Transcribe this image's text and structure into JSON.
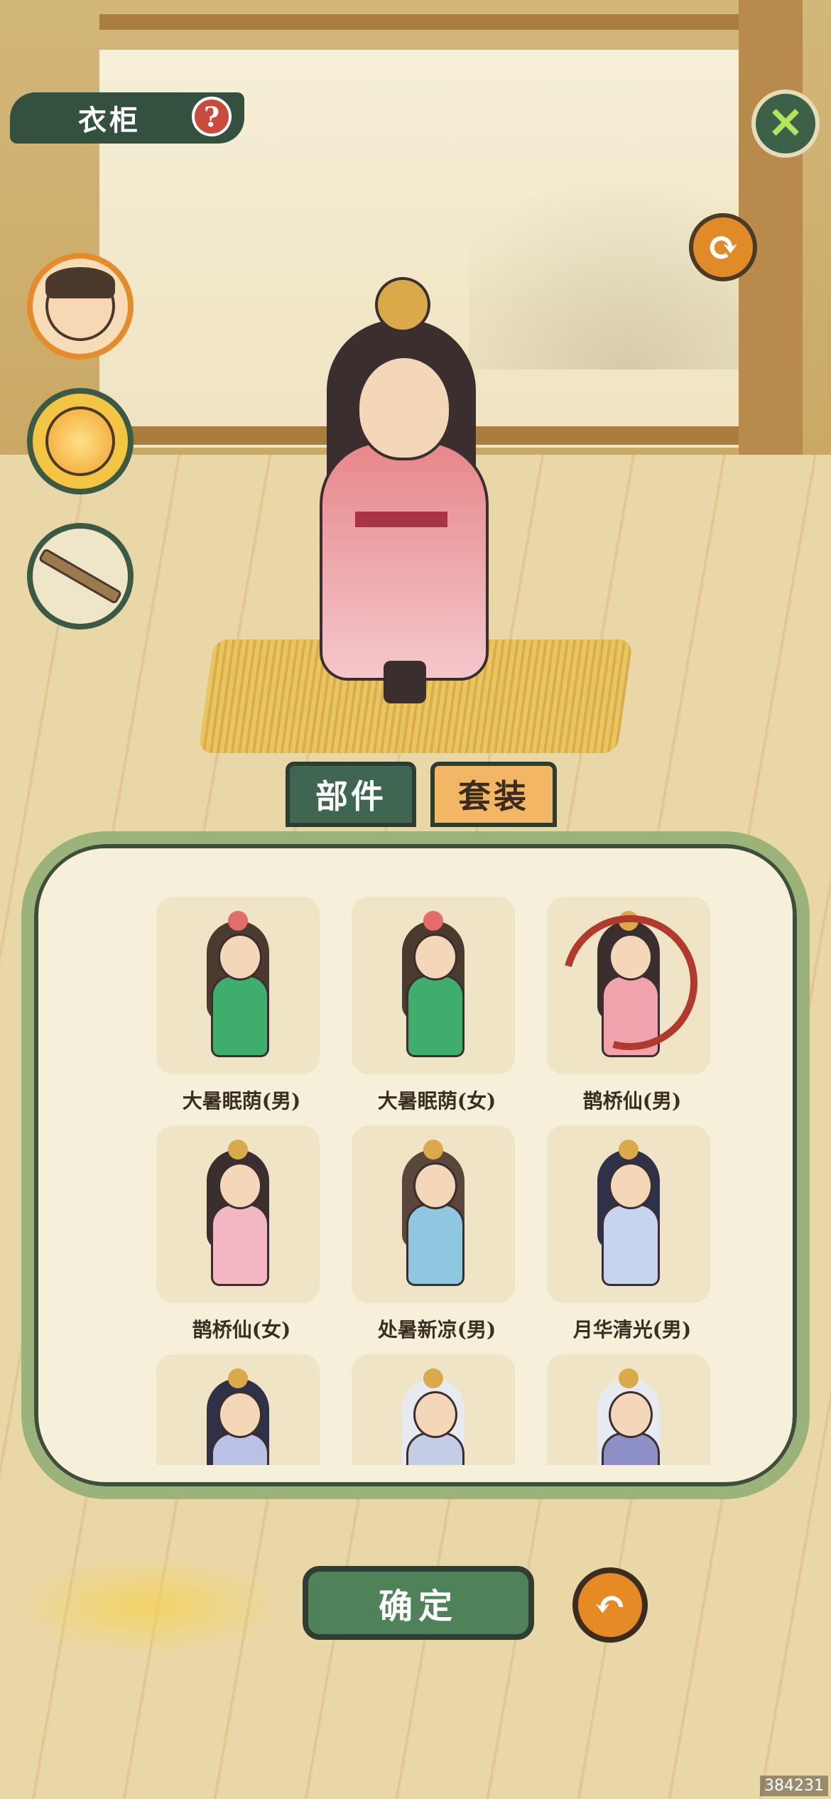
{
  "header": {
    "title": "衣柜",
    "help_icon": "?",
    "close_icon": "✕",
    "refresh_icon": "⟳"
  },
  "side_categories": [
    {
      "name": "face",
      "active": true
    },
    {
      "name": "fire-aura",
      "active": false
    },
    {
      "name": "weapon",
      "active": false
    }
  ],
  "tabs": [
    {
      "label": "部件",
      "selected": false
    },
    {
      "label": "套装",
      "selected": true
    }
  ],
  "outfits": [
    {
      "label": "大暑眠荫(男)",
      "hair": "#4b3a2e",
      "body": "#3fae6d",
      "orn": "#e36c6c",
      "selected": false
    },
    {
      "label": "大暑眠荫(女)",
      "hair": "#4b3a2e",
      "body": "#3fae6d",
      "orn": "#e36c6c",
      "selected": false
    },
    {
      "label": "鹊桥仙(男)",
      "hair": "#3a2e2e",
      "body": "#f0a3ad",
      "orn": "#d9a94a",
      "selected": true
    },
    {
      "label": "鹊桥仙(女)",
      "hair": "#3a2e2e",
      "body": "#f4b8c4",
      "orn": "#d9a94a",
      "selected": false
    },
    {
      "label": "处暑新凉(男)",
      "hair": "#5a463a",
      "body": "#8fc6e0",
      "orn": "#d9a94a",
      "selected": false
    },
    {
      "label": "月华清光(男)",
      "hair": "#2e3147",
      "body": "#c7d4ef",
      "orn": "#d9a94a",
      "selected": false
    },
    {
      "label": "",
      "hair": "#2e3147",
      "body": "#b9c1e6",
      "orn": "#d9a94a",
      "selected": false
    },
    {
      "label": "",
      "hair": "#e8eaf2",
      "body": "#c4cde6",
      "orn": "#d9a94a",
      "selected": false
    },
    {
      "label": "",
      "hair": "#e8eaf2",
      "body": "#8d8fc7",
      "orn": "#d9a94a",
      "selected": false
    }
  ],
  "footer": {
    "confirm_label": "确定",
    "undo_icon": "↶"
  },
  "watermark": "384231"
}
